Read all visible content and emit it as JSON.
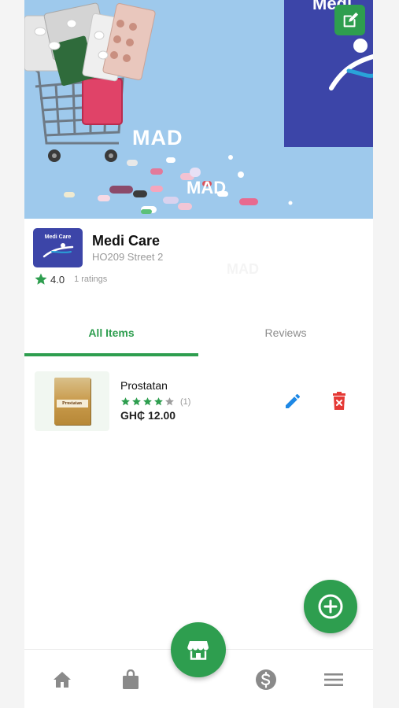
{
  "banner": {
    "watermark_large": "MAD",
    "watermark_small": "MAD",
    "brand_panel_text": "Medi"
  },
  "store": {
    "logo_text": "Medi Care",
    "name": "Medi Care",
    "address": "HO209 Street 2",
    "rating": "4.0",
    "ratings_count": "1 ratings",
    "watermark": "MAD"
  },
  "tabs": [
    {
      "label": "All Items",
      "active": true
    },
    {
      "label": "Reviews",
      "active": false
    }
  ],
  "products": [
    {
      "name": "Prostatan",
      "box_label": "Prostatan",
      "stars": 4,
      "rating_count": "(1)",
      "price": "GH₵ 12.00"
    }
  ],
  "icons": {
    "edit_banner": "edit-square-icon",
    "star": "star-icon",
    "edit": "pencil-icon",
    "delete": "trash-icon",
    "add": "plus-circle-icon",
    "nav_home": "home-icon",
    "nav_shop": "shopping-bag-icon",
    "nav_store": "storefront-icon",
    "nav_money": "dollar-circle-icon",
    "nav_menu": "menu-icon"
  },
  "colors": {
    "primary_green": "#2e9e4f",
    "banner_blue": "#9ec9ec",
    "brand_blue": "#3c45a8",
    "edit_blue": "#1e88e5",
    "delete_red": "#e53935",
    "nav_gray": "#8a8a8a"
  }
}
